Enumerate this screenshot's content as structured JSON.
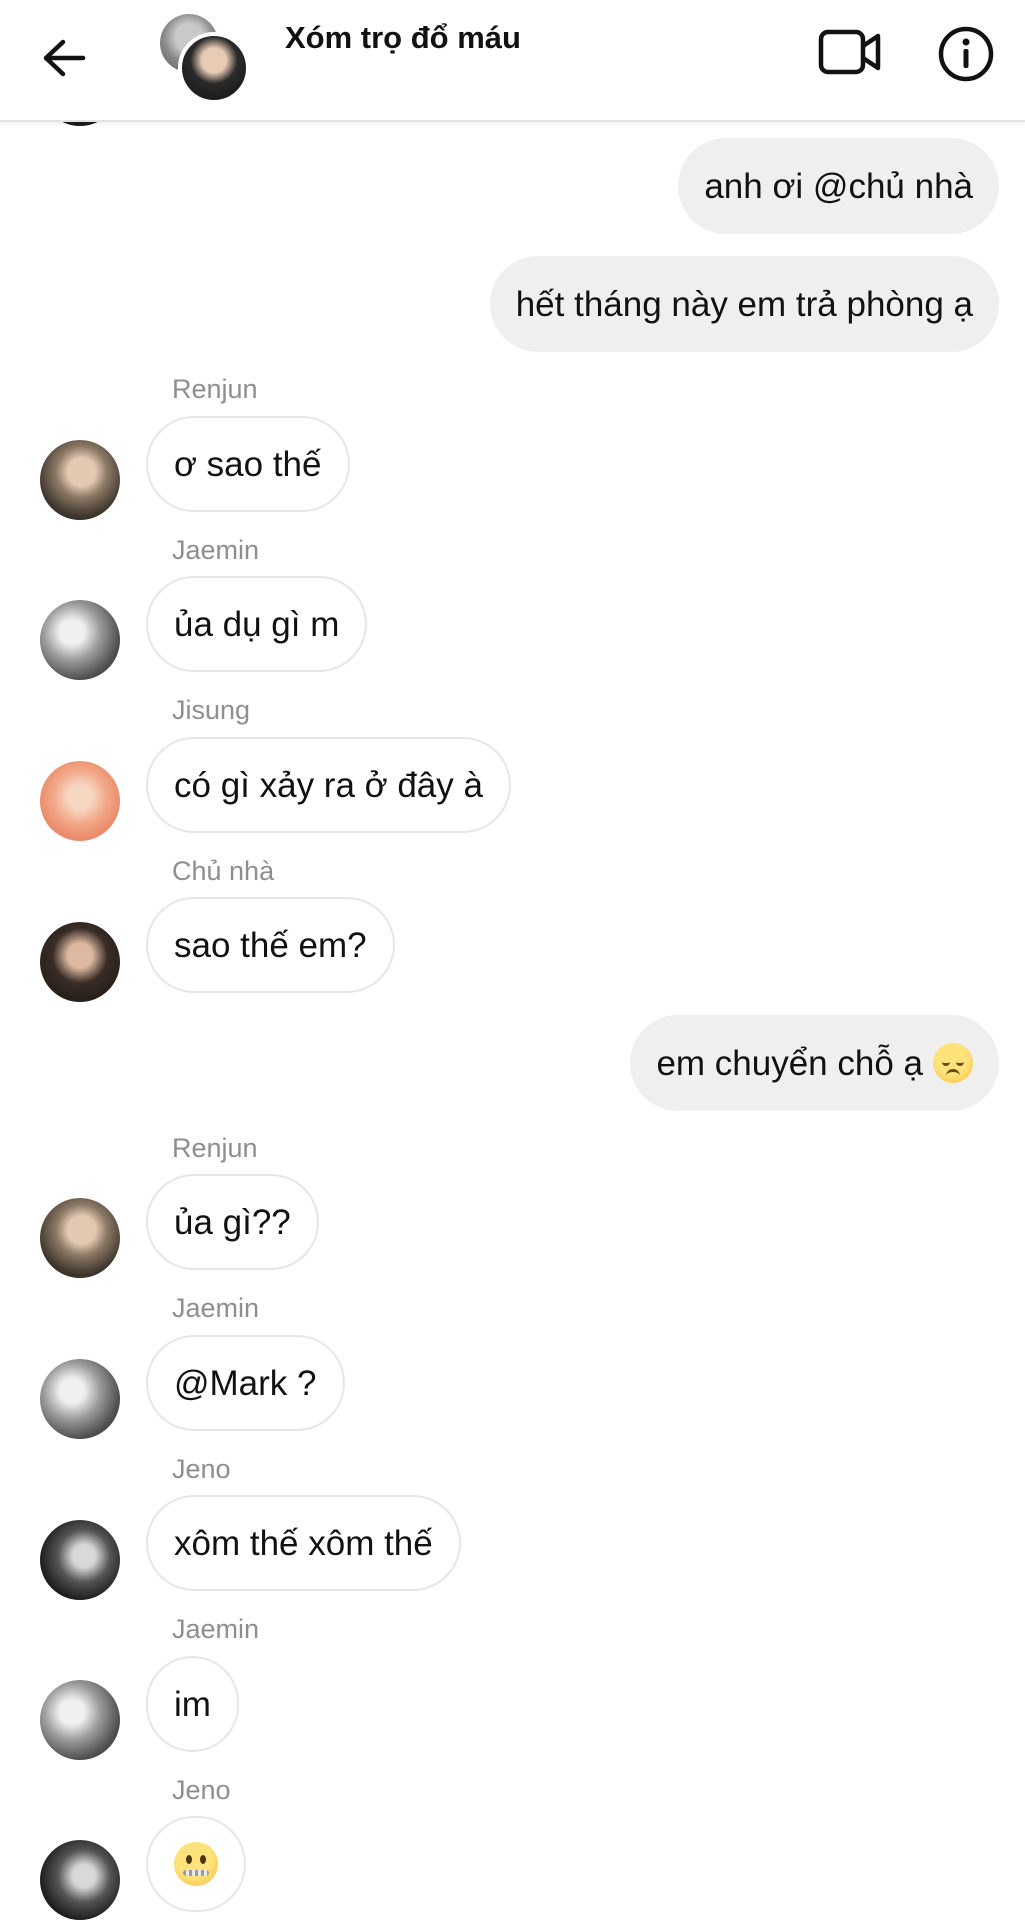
{
  "header": {
    "title": "Xóm trọ đổ máu",
    "back_icon": "arrow-left-icon",
    "video_icon": "video-camera-icon",
    "info_icon": "info-icon"
  },
  "messages": [
    {
      "direction": "out",
      "text": "anh ơi @chủ nhà"
    },
    {
      "direction": "out",
      "text": "hết tháng này em trả phòng ạ"
    },
    {
      "direction": "in",
      "sender": "Renjun",
      "text": "ơ sao thế"
    },
    {
      "direction": "in",
      "sender": "Jaemin",
      "text": "ủa dụ gì m"
    },
    {
      "direction": "in",
      "sender": "Jisung",
      "text": "có gì xảy ra ở đây à"
    },
    {
      "direction": "in",
      "sender": "Chủ nhà",
      "text": "sao thế em?"
    },
    {
      "direction": "out",
      "text": "em chuyển chỗ ạ",
      "emoji": "pensive-face"
    },
    {
      "direction": "in",
      "sender": "Renjun",
      "text": "ủa gì??"
    },
    {
      "direction": "in",
      "sender": "Jaemin",
      "text": "@Mark ?"
    },
    {
      "direction": "in",
      "sender": "Jeno",
      "text": "xôm thế xôm thế"
    },
    {
      "direction": "in",
      "sender": "Jaemin",
      "text": "im"
    },
    {
      "direction": "in",
      "sender": "Jeno",
      "emoji": "zipper-mouth-face"
    }
  ]
}
